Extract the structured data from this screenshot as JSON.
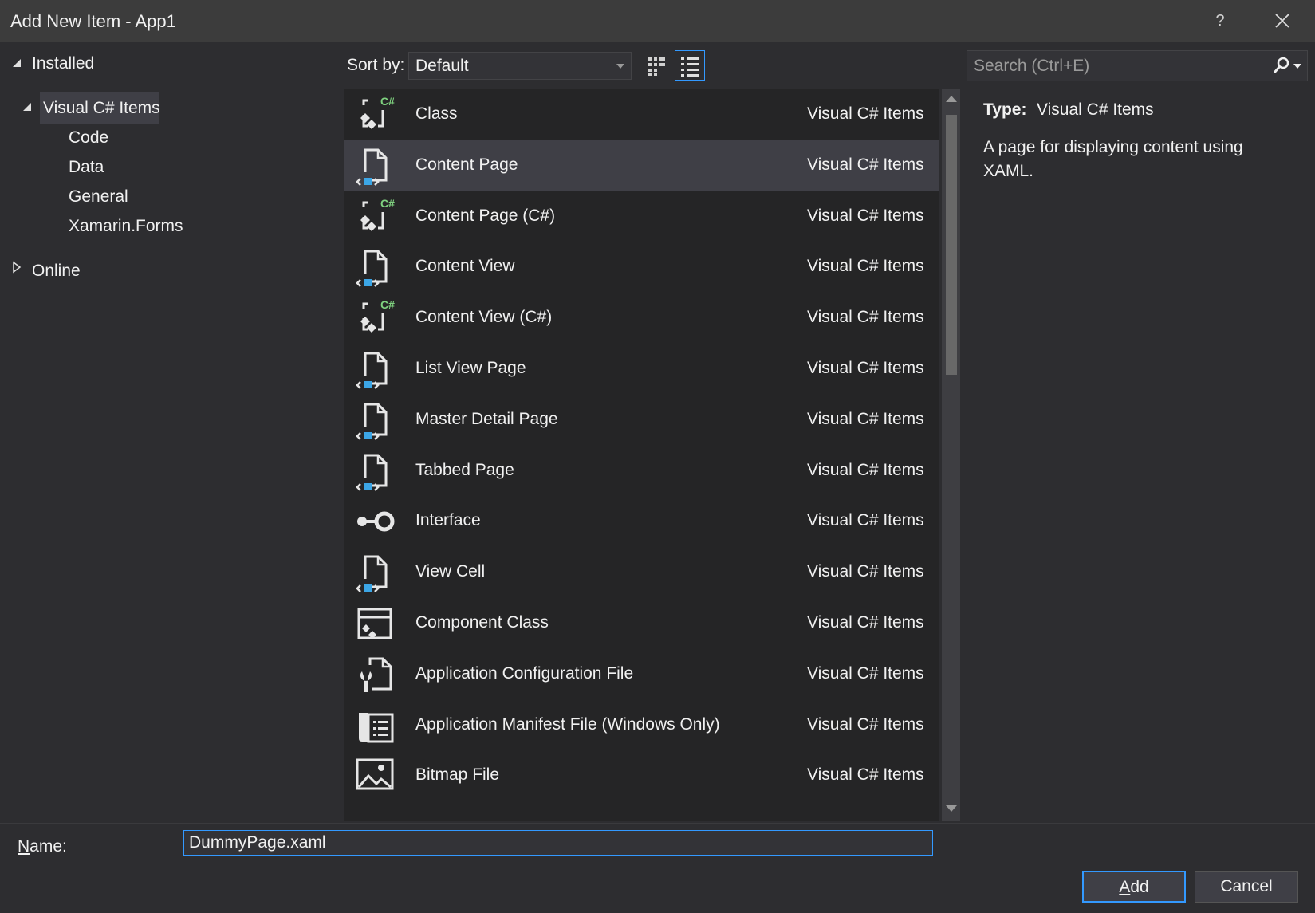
{
  "window": {
    "title": "Add New Item - App1",
    "help_label": "?",
    "close_icon": "close-icon"
  },
  "tree": {
    "installed": "Installed",
    "visual_cs": "Visual C# Items",
    "children": [
      "Code",
      "Data",
      "General",
      "Xamarin.Forms"
    ],
    "online": "Online"
  },
  "toolbar": {
    "sort_label": "Sort by:",
    "sort_value": "Default",
    "grid_icon": "small-icons-view-icon",
    "list_icon": "list-view-icon"
  },
  "search": {
    "placeholder": "Search (Ctrl+E)",
    "icon": "search-icon"
  },
  "items": [
    {
      "name": "Class",
      "category": "Visual C# Items",
      "icon": "csharp-class-icon"
    },
    {
      "name": "Content Page",
      "category": "Visual C# Items",
      "icon": "xaml-page-icon",
      "selected": true
    },
    {
      "name": "Content Page (C#)",
      "category": "Visual C# Items",
      "icon": "csharp-class-icon"
    },
    {
      "name": "Content View",
      "category": "Visual C# Items",
      "icon": "xaml-page-icon"
    },
    {
      "name": "Content View (C#)",
      "category": "Visual C# Items",
      "icon": "csharp-class-icon"
    },
    {
      "name": "List View Page",
      "category": "Visual C# Items",
      "icon": "xaml-page-icon"
    },
    {
      "name": "Master Detail Page",
      "category": "Visual C# Items",
      "icon": "xaml-page-icon"
    },
    {
      "name": "Tabbed Page",
      "category": "Visual C# Items",
      "icon": "xaml-page-icon"
    },
    {
      "name": "Interface",
      "category": "Visual C# Items",
      "icon": "interface-icon"
    },
    {
      "name": "View Cell",
      "category": "Visual C# Items",
      "icon": "xaml-page-icon"
    },
    {
      "name": "Component Class",
      "category": "Visual C# Items",
      "icon": "component-class-icon"
    },
    {
      "name": "Application Configuration File",
      "category": "Visual C# Items",
      "icon": "config-file-icon"
    },
    {
      "name": "Application Manifest File (Windows Only)",
      "category": "Visual C# Items",
      "icon": "manifest-file-icon"
    },
    {
      "name": "Bitmap File",
      "category": "Visual C# Items",
      "icon": "bitmap-file-icon"
    }
  ],
  "details": {
    "type_label": "Type:",
    "type_value": "Visual C# Items",
    "description": "A page for displaying content using XAML."
  },
  "footer": {
    "name_label": "Name:",
    "name_value": "DummyPage.xaml",
    "add_label": "Add",
    "cancel_label": "Cancel"
  },
  "colors": {
    "accent": "#3399ff",
    "background": "#2d2d30",
    "list_bg": "#252526",
    "selected": "#3f3f46",
    "csharp_green": "#7fd17f",
    "xaml_blue": "#3ca6e6"
  }
}
